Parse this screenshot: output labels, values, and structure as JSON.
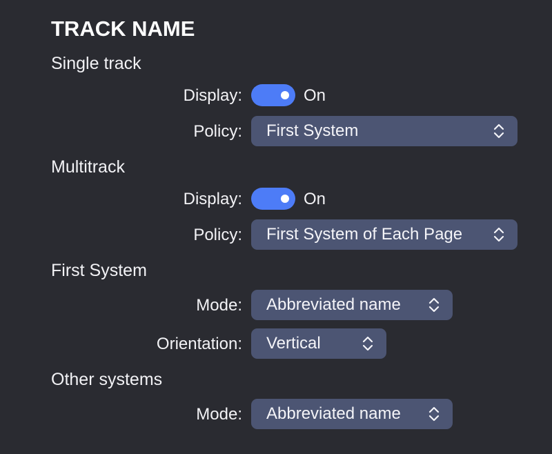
{
  "title": "TRACK NAME",
  "single_track": {
    "heading": "Single track",
    "display_label": "Display:",
    "display_state": "On",
    "display_on": true,
    "policy_label": "Policy:",
    "policy_value": "First System"
  },
  "multitrack": {
    "heading": "Multitrack",
    "display_label": "Display:",
    "display_state": "On",
    "display_on": true,
    "policy_label": "Policy:",
    "policy_value": "First System of Each Page"
  },
  "first_system": {
    "heading": "First System",
    "mode_label": "Mode:",
    "mode_value": "Abbreviated name",
    "orientation_label": "Orientation:",
    "orientation_value": "Vertical"
  },
  "other_systems": {
    "heading": "Other systems",
    "mode_label": "Mode:",
    "mode_value": "Abbreviated name"
  },
  "colors": {
    "background": "#2a2b31",
    "toggle_on": "#4d7cf7",
    "select_bg": "#4c5573",
    "text": "#f2f2f5"
  },
  "icons": {
    "select_arrow": "chevron-up-down-icon"
  }
}
